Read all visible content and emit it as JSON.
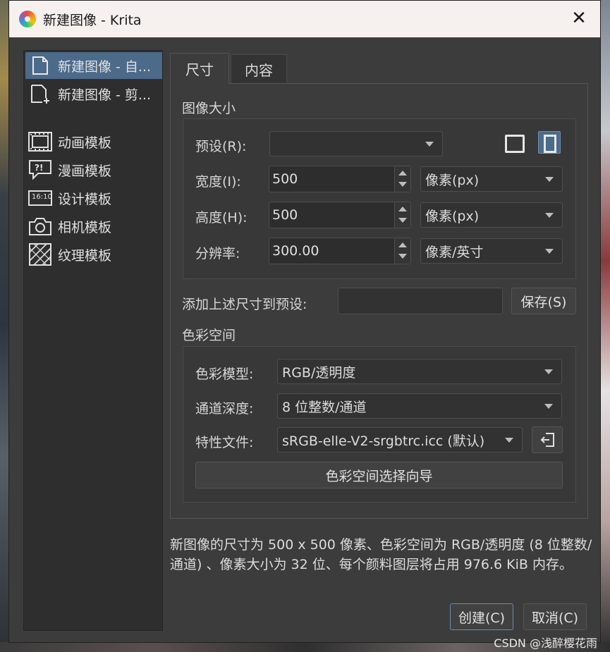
{
  "window": {
    "title": "新建图像 - Krita",
    "close_glyph": "✕"
  },
  "sidebar": {
    "items": [
      {
        "label": "新建图像 - 自...",
        "icon": "blank-page-icon",
        "selected": true
      },
      {
        "label": "新建图像 - 剪...",
        "icon": "clipboard-page-icon",
        "selected": false
      },
      {
        "label": "动画模板",
        "icon": "film-icon",
        "selected": false
      },
      {
        "label": "漫画模板",
        "icon": "speech-bubble-icon",
        "selected": false
      },
      {
        "label": "设计模板",
        "icon": "aspect-ratio-icon",
        "selected": false
      },
      {
        "label": "相机模板",
        "icon": "camera-icon",
        "selected": false
      },
      {
        "label": "纹理模板",
        "icon": "texture-icon",
        "selected": false
      }
    ],
    "aspect_icon_text": "16:10"
  },
  "tabs": [
    {
      "label": "尺寸",
      "active": true
    },
    {
      "label": "内容",
      "active": false
    }
  ],
  "image_size": {
    "section_title": "图像大小",
    "preset_label": "预设(R):",
    "preset_value": "",
    "width_label": "宽度(I):",
    "width_value": "500",
    "width_unit": "像素(px)",
    "height_label": "高度(H):",
    "height_value": "500",
    "height_unit": "像素(px)",
    "resolution_label": "分辨率:",
    "resolution_value": "300.00",
    "resolution_unit": "像素/英寸"
  },
  "save_preset": {
    "label": "添加上述尺寸到预设:",
    "input_value": "",
    "button_label": "保存(S)"
  },
  "color_space": {
    "section_title": "色彩空间",
    "model_label": "色彩模型:",
    "model_value": "RGB/透明度",
    "depth_label": "通道深度:",
    "depth_value": "8 位整数/通道",
    "profile_label": "特性文件:",
    "profile_value": "sRGB-elle-V2-srgbtrc.icc (默认)",
    "wizard_button": "色彩空间选择向导"
  },
  "summary": "新图像的尺寸为 500 x 500 像素、色彩空间为 RGB/透明度 (8 位整数/通道) 、像素大小为 32 位、每个颜料图层将占用 976.6 KiB 内存。",
  "footer": {
    "create_label": "创建(C)",
    "cancel_label": "取消(C)"
  },
  "watermark": "CSDN @浅醉樱花雨",
  "colors": {
    "selection": "#4c6a8a",
    "titlebar": "#f6f0ef",
    "window_bg": "#3c3c3c"
  }
}
